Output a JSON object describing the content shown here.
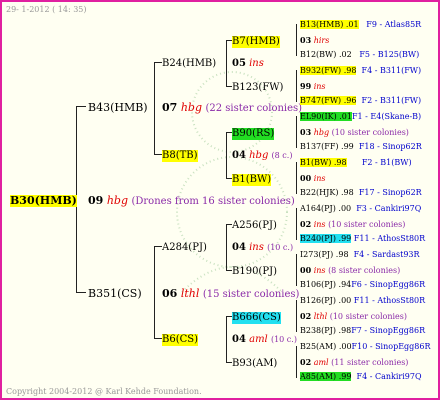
{
  "header": {
    "date": "29-  1-2012 ( 14: 35)"
  },
  "footer": {
    "copyright": "Copyright 2004-2012 @ Karl Kehde Foundation."
  },
  "root": {
    "label": "B30(HMB)",
    "num": "09",
    "sym": "hbg",
    "desc": "(Drones from 16 sister colonies)"
  },
  "g1": {
    "top": {
      "label": "B43(HMB)",
      "num": "07",
      "sym": "hbg",
      "desc": "(22 sister colonies)"
    },
    "bot": {
      "label": "B351(CS)",
      "num": "06",
      "sym": "lthl",
      "desc": "(15 sister colonies)"
    }
  },
  "g2": {
    "a": {
      "label": "B24(HMB)",
      "num": "05",
      "sym": "ins"
    },
    "b": {
      "label": "B8(TB)",
      "num": "04",
      "sym": "hbg",
      "desc": "(8 c.)"
    },
    "c": {
      "label": "A284(PJ)",
      "num": "04",
      "sym": "ins",
      "desc": "(10 c.)"
    },
    "d": {
      "label": "B6(CS)",
      "num": "04",
      "sym": "aml",
      "desc": "(10 c.)"
    }
  },
  "g3": {
    "a1": "B7(HMB)",
    "a2": "B123(FW)",
    "b1": "B90(RS)",
    "b2": "B1(BW)",
    "c1": "A256(PJ)",
    "c2": "B190(PJ)",
    "d1": "B666(CS)",
    "d2": "B93(AM)"
  },
  "g4": [
    {
      "name": "B13(HMB) .01",
      "ref": "F9 - Atlas85R"
    },
    {
      "num": "03",
      "sym": "hirs"
    },
    {
      "name": "B12(BW) .02",
      "ref": "F5 - B125(BW)"
    },
    {
      "name": "B932(FW) .98",
      "ref": "F4 - B311(FW)"
    },
    {
      "num": "99",
      "sym": "ins"
    },
    {
      "name": "B747(FW) .96",
      "ref": "F2 - B311(FW)"
    },
    {
      "name": "EL90(IK) .01",
      "ref": "F1 - E4(Skane-B)"
    },
    {
      "num": "03",
      "sym": "hbg",
      "desc": "(10 sister colonies)"
    },
    {
      "name": "B137(FF) .99",
      "ref": "F18 - Sinop62R"
    },
    {
      "name": "B1(BW) .98",
      "ref": "F2 - B1(BW)"
    },
    {
      "num": "00",
      "sym": "ins"
    },
    {
      "name": "B22(HJK) .98",
      "ref": "F17 - Sinop62R"
    },
    {
      "name": "A164(PJ) .00",
      "ref": "F3 - Cankiri97Q"
    },
    {
      "num": "02",
      "sym": "ins",
      "desc": "(10 sister colonies)"
    },
    {
      "name": "B240(PJ) .99",
      "ref": "F11 - AthosSt80R"
    },
    {
      "name": "I273(PJ) .98",
      "ref": "F4 - Sardast93R"
    },
    {
      "num": "00",
      "sym": "ins",
      "desc": "(8 sister colonies)"
    },
    {
      "name": "B106(PJ) .94",
      "ref": "F6 - SinopEgg86R"
    },
    {
      "name": "B126(PJ) .00",
      "ref": "F11 - AthosSt80R"
    },
    {
      "num": "02",
      "sym": "lthl",
      "desc": "(10 sister colonies)"
    },
    {
      "name": "B238(PJ) .98",
      "ref": "F7 - SinopEgg86R"
    },
    {
      "name": "B25(AM) .00",
      "ref": "F10 - SinopEgg86R"
    },
    {
      "num": "02",
      "sym": "aml",
      "desc": "(11 sister colonies)"
    },
    {
      "name": "A85(AM) .99",
      "ref": "F4 - Cankiri97Q"
    }
  ],
  "colors": {
    "border": "#e020a0",
    "highlight": "#ffff00",
    "green": "#22dd22",
    "cyan": "#22e0f0",
    "red": "#e00000",
    "purple": "#8a2aa8",
    "blue": "#0000cc"
  }
}
